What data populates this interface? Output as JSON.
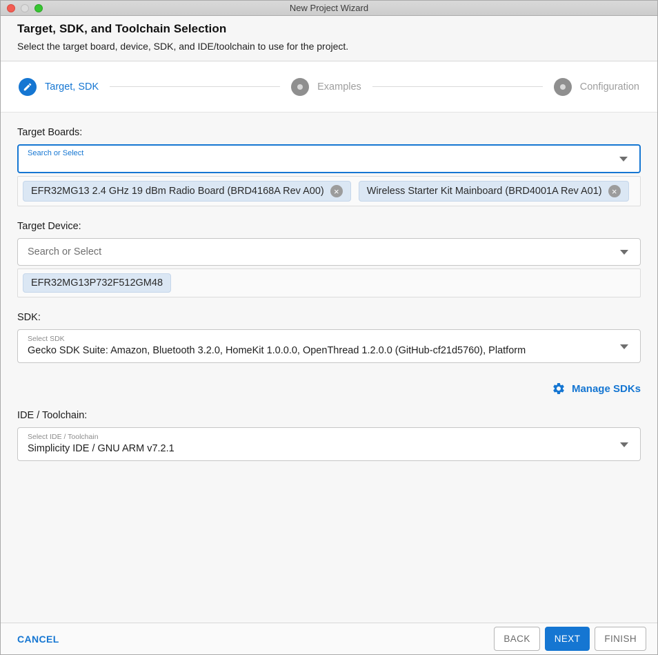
{
  "window": {
    "title": "New Project Wizard"
  },
  "header": {
    "title": "Target, SDK, and Toolchain Selection",
    "subtitle": "Select the target board, device, SDK, and IDE/toolchain to use for the project."
  },
  "stepper": {
    "steps": [
      {
        "label": "Target, SDK",
        "state": "active",
        "icon": "pencil-icon"
      },
      {
        "label": "Examples",
        "state": "pending",
        "icon": "step-dot-icon"
      },
      {
        "label": "Configuration",
        "state": "pending",
        "icon": "step-dot-icon"
      }
    ]
  },
  "form": {
    "target_boards": {
      "label": "Target Boards:",
      "placeholder": "Search or Select",
      "chips": [
        {
          "text": "EFR32MG13 2.4 GHz 19 dBm Radio Board (BRD4168A Rev A00)",
          "removable": true
        },
        {
          "text": "Wireless Starter Kit Mainboard (BRD4001A Rev A01)",
          "removable": true
        }
      ]
    },
    "target_device": {
      "label": "Target Device:",
      "placeholder": "Search or Select",
      "chips": [
        {
          "text": "EFR32MG13P732F512GM48",
          "removable": false
        }
      ]
    },
    "sdk": {
      "label": "SDK:",
      "select_label": "Select SDK",
      "value": "Gecko SDK Suite: Amazon, Bluetooth 3.2.0, HomeKit 1.0.0.0, OpenThread 1.2.0.0 (GitHub-cf21d5760), Platform",
      "manage_label": "Manage SDKs"
    },
    "ide": {
      "label": "IDE / Toolchain:",
      "select_label": "Select IDE / Toolchain",
      "value": "Simplicity IDE / GNU ARM v7.2.1"
    }
  },
  "footer": {
    "cancel": "CANCEL",
    "back": "BACK",
    "next": "NEXT",
    "finish": "FINISH"
  },
  "icons": {
    "remove_chip": "×"
  },
  "colors": {
    "accent_blue": "#1576d2",
    "chip_bg": "#dbe7f4",
    "step_gray": "#8f8f8f"
  }
}
